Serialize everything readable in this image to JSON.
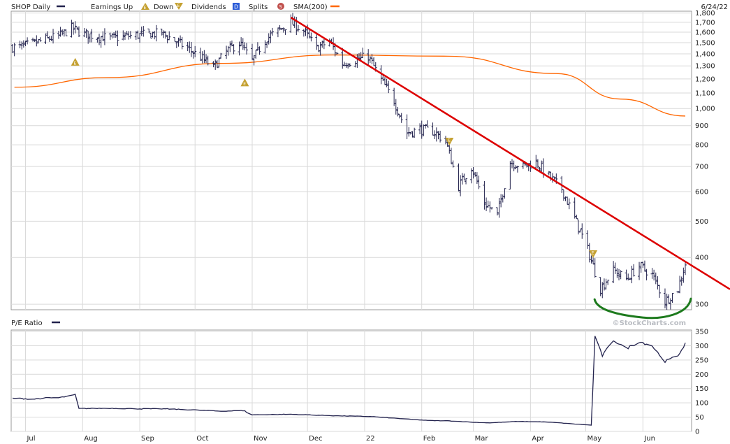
{
  "chart_data": [
    {
      "type": "ohlc",
      "legend": {
        "symbol": "SHOP Daily",
        "earnings_up": "Earnings Up",
        "earnings_down": "Down",
        "dividends": "Dividends",
        "splits": "Splits",
        "sma": "SMA(200)"
      },
      "date_label": "6/24/22",
      "watermark": "©StockCharts.com",
      "x_labels": [
        "Jul",
        "Aug",
        "Sep",
        "Oct",
        "Nov",
        "Dec",
        "22",
        "Feb",
        "Mar",
        "Apr",
        "May",
        "Jun"
      ],
      "y_ticks": [
        300,
        400,
        500,
        600,
        700,
        800,
        900,
        1000,
        1100,
        1200,
        1300,
        1400,
        1500,
        1600,
        1700,
        1800
      ],
      "y_tick_labels": [
        "300",
        "400",
        "500",
        "600",
        "700",
        "800",
        "900",
        "1,000",
        "1,100",
        "1,200",
        "1,300",
        "1,400",
        "1,500",
        "1,600",
        "1,700",
        "1,800"
      ],
      "ylim": [
        290,
        1820
      ],
      "y_scale": "log",
      "grid": true,
      "price_anchors": [
        [
          "2021-06-28",
          1460
        ],
        [
          "2021-07-05",
          1490
        ],
        [
          "2021-07-12",
          1530
        ],
        [
          "2021-07-19",
          1560
        ],
        [
          "2021-07-26",
          1640
        ],
        [
          "2021-08-02",
          1580
        ],
        [
          "2021-08-16",
          1540
        ],
        [
          "2021-08-30",
          1570
        ],
        [
          "2021-09-13",
          1590
        ],
        [
          "2021-09-27",
          1450
        ],
        [
          "2021-10-04",
          1370
        ],
        [
          "2021-10-11",
          1290
        ],
        [
          "2021-10-18",
          1420
        ],
        [
          "2021-10-25",
          1500
        ],
        [
          "2021-11-01",
          1340
        ],
        [
          "2021-11-08",
          1530
        ],
        [
          "2021-11-22",
          1700
        ],
        [
          "2021-11-29",
          1610
        ],
        [
          "2021-12-06",
          1450
        ],
        [
          "2021-12-13",
          1510
        ],
        [
          "2021-12-20",
          1320
        ],
        [
          "2022-01-03",
          1380
        ],
        [
          "2022-01-10",
          1190
        ],
        [
          "2022-01-17",
          1050
        ],
        [
          "2022-01-24",
          860
        ],
        [
          "2022-01-31",
          880
        ],
        [
          "2022-02-07",
          870
        ],
        [
          "2022-02-14",
          820
        ],
        [
          "2022-02-21",
          620
        ],
        [
          "2022-02-28",
          700
        ],
        [
          "2022-03-07",
          560
        ],
        [
          "2022-03-14",
          520
        ],
        [
          "2022-03-21",
          720
        ],
        [
          "2022-03-28",
          700
        ],
        [
          "2022-04-04",
          720
        ],
        [
          "2022-04-11",
          660
        ],
        [
          "2022-04-18",
          610
        ],
        [
          "2022-04-25",
          510
        ],
        [
          "2022-05-02",
          420
        ],
        [
          "2022-05-09",
          330
        ],
        [
          "2022-05-16",
          370
        ],
        [
          "2022-05-23",
          350
        ],
        [
          "2022-05-30",
          380
        ],
        [
          "2022-06-06",
          360
        ],
        [
          "2022-06-13",
          305
        ],
        [
          "2022-06-20",
          330
        ],
        [
          "2022-06-24",
          385
        ]
      ],
      "sma_200": [
        [
          "2021-06-25",
          1140
        ],
        [
          "2021-08-15",
          1210
        ],
        [
          "2021-10-15",
          1320
        ],
        [
          "2021-12-15",
          1390
        ],
        [
          "2022-02-15",
          1380
        ],
        [
          "2022-04-15",
          1240
        ],
        [
          "2022-05-20",
          1060
        ],
        [
          "2022-06-24",
          955
        ]
      ],
      "earnings_markers": [
        {
          "date": "2021-07-28",
          "direction": "up",
          "label": "E"
        },
        {
          "date": "2021-10-28",
          "direction": "up",
          "label": "E"
        },
        {
          "date": "2022-02-16",
          "direction": "down",
          "label": "E"
        },
        {
          "date": "2022-05-05",
          "direction": "down",
          "label": "E"
        }
      ],
      "annotations": [
        {
          "type": "trendline",
          "color": "#dd0000",
          "points": [
            [
              "2021-11-22",
              1750
            ],
            [
              "2022-06-24",
              390
            ]
          ],
          "extends_right": true
        },
        {
          "type": "freehand-arc",
          "color": "#1d7a1d",
          "from": "2022-05-02",
          "to": "2022-06-24",
          "near_price": 300
        }
      ],
      "colors": {
        "bars": "#22224d",
        "sma": "#ff6600",
        "trendline": "#dd0000",
        "highlight": "#1d7a1d",
        "grid": "#d9d9d9",
        "marker": "#c4a030"
      }
    },
    {
      "type": "line",
      "title": "P/E Ratio",
      "y_ticks": [
        0,
        50,
        100,
        150,
        200,
        250,
        300,
        350
      ],
      "ylim": [
        0,
        355
      ],
      "grid": true,
      "series": [
        {
          "name": "P/E Ratio",
          "color": "#22224d",
          "values": [
            [
              "2021-06-25",
              116
            ],
            [
              "2021-07-05",
              113
            ],
            [
              "2021-07-12",
              117
            ],
            [
              "2021-07-19",
              118
            ],
            [
              "2021-07-26",
              125
            ],
            [
              "2021-07-28",
              129
            ],
            [
              "2021-07-30",
              80
            ],
            [
              "2021-08-15",
              81
            ],
            [
              "2021-09-01",
              79
            ],
            [
              "2021-09-15",
              79
            ],
            [
              "2021-10-01",
              75
            ],
            [
              "2021-10-15",
              71
            ],
            [
              "2021-10-28",
              73
            ],
            [
              "2021-10-30",
              58
            ],
            [
              "2021-11-22",
              60
            ],
            [
              "2021-12-15",
              55
            ],
            [
              "2022-01-05",
              52
            ],
            [
              "2022-01-20",
              45
            ],
            [
              "2022-02-05",
              38
            ],
            [
              "2022-02-16",
              37
            ],
            [
              "2022-03-01",
              32
            ],
            [
              "2022-03-10",
              30
            ],
            [
              "2022-03-25",
              35
            ],
            [
              "2022-04-10",
              33
            ],
            [
              "2022-04-25",
              26
            ],
            [
              "2022-05-04",
              22
            ],
            [
              "2022-05-06",
              330
            ],
            [
              "2022-05-10",
              265
            ],
            [
              "2022-05-16",
              320
            ],
            [
              "2022-05-23",
              290
            ],
            [
              "2022-05-30",
              315
            ],
            [
              "2022-06-06",
              300
            ],
            [
              "2022-06-13",
              245
            ],
            [
              "2022-06-20",
              265
            ],
            [
              "2022-06-24",
              308
            ]
          ]
        }
      ]
    }
  ]
}
